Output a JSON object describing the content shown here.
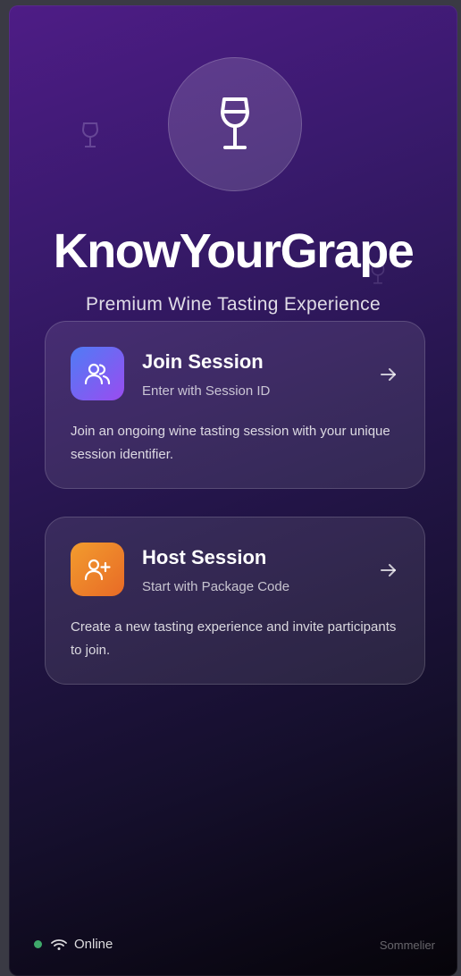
{
  "app": {
    "title": "KnowYourGrape",
    "subtitle": "Premium Wine Tasting Experience",
    "logo_icon": "wine-glass-icon"
  },
  "cards": {
    "join": {
      "title": "Join Session",
      "subtitle": "Enter with Session ID",
      "description": "Join an ongoing wine tasting session with your unique session identifier.",
      "icon": "users-icon",
      "gradient": [
        "#4f7cf5",
        "#9a4cf0"
      ]
    },
    "host": {
      "title": "Host Session",
      "subtitle": "Start with Package Code",
      "description": "Create a new tasting experience and invite participants to join.",
      "icon": "user-plus-icon",
      "gradient": [
        "#f29c2e",
        "#e86a26"
      ]
    }
  },
  "status": {
    "label": "Online",
    "dot_color": "#3fa86a",
    "icon": "wifi-icon"
  },
  "footer": {
    "brand": "Sommelier"
  },
  "colors": {
    "background_top": "#4e1c86",
    "background_bottom": "#060409"
  }
}
